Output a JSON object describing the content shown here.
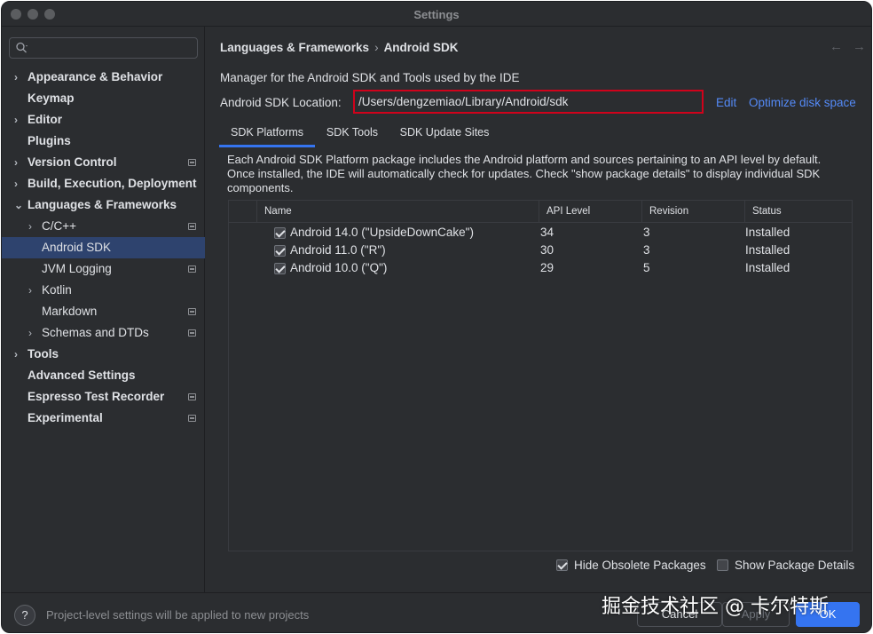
{
  "window": {
    "title": "Settings"
  },
  "sidebar": {
    "search": {
      "placeholder": "",
      "value": ""
    },
    "items": [
      {
        "label": "Appearance & Behavior",
        "chevron": "›",
        "bold": true
      },
      {
        "label": "Keymap",
        "chevron": "",
        "bold": true
      },
      {
        "label": "Editor",
        "chevron": "›",
        "bold": true
      },
      {
        "label": "Plugins",
        "chevron": "",
        "bold": true
      },
      {
        "label": "Version Control",
        "chevron": "›",
        "bold": true,
        "project": true
      },
      {
        "label": "Build, Execution, Deployment",
        "chevron": "›",
        "bold": true
      },
      {
        "label": "Languages & Frameworks",
        "chevron": "⌄",
        "bold": true
      },
      {
        "label": "C/C++",
        "chevron": "›",
        "bold": false,
        "project": true
      },
      {
        "label": "Android SDK",
        "chevron": "",
        "bold": false,
        "selected": true
      },
      {
        "label": "JVM Logging",
        "chevron": "",
        "bold": false,
        "project": true
      },
      {
        "label": "Kotlin",
        "chevron": "›",
        "bold": false
      },
      {
        "label": "Markdown",
        "chevron": "",
        "bold": false,
        "project": true
      },
      {
        "label": "Schemas and DTDs",
        "chevron": "›",
        "bold": false,
        "project": true
      },
      {
        "label": "Tools",
        "chevron": "›",
        "bold": true
      },
      {
        "label": "Advanced Settings",
        "chevron": "",
        "bold": true
      },
      {
        "label": "Espresso Test Recorder",
        "chevron": "",
        "bold": true,
        "project": true
      },
      {
        "label": "Experimental",
        "chevron": "",
        "bold": true,
        "project": true
      }
    ]
  },
  "breadcrumb": {
    "parent": "Languages & Frameworks",
    "separator": "›",
    "current": "Android SDK"
  },
  "nav": {
    "back": "←",
    "forward": "→"
  },
  "main": {
    "description": "Manager for the Android SDK and Tools used by the IDE",
    "location_label": "Android SDK Location:",
    "location_value": "/Users/dengzemiao/Library/Android/sdk",
    "edit_link": "Edit",
    "optimize_link": "Optimize disk space",
    "tabs": [
      {
        "label": "SDK Platforms",
        "active": true
      },
      {
        "label": "SDK Tools",
        "active": false
      },
      {
        "label": "SDK Update Sites",
        "active": false
      }
    ],
    "intro": "Each Android SDK Platform package includes the Android platform and sources pertaining to an API level by default. Once installed, the IDE will automatically check for updates. Check \"show package details\" to display individual SDK components.",
    "table": {
      "columns": [
        "Name",
        "API Level",
        "Revision",
        "Status"
      ],
      "rows": [
        {
          "checked": true,
          "name": "Android 14.0 (\"UpsideDownCake\")",
          "api": "34",
          "revision": "3",
          "status": "Installed"
        },
        {
          "checked": true,
          "name": "Android 11.0 (\"R\")",
          "api": "30",
          "revision": "3",
          "status": "Installed"
        },
        {
          "checked": true,
          "name": "Android 10.0 (\"Q\")",
          "api": "29",
          "revision": "5",
          "status": "Installed"
        }
      ]
    },
    "hide_obsolete": {
      "label": "Hide Obsolete Packages",
      "checked": true
    },
    "show_details": {
      "label": "Show Package Details",
      "checked": false
    }
  },
  "footer": {
    "help": "?",
    "note": "Project-level settings will be applied to new projects",
    "cancel": "Cancel",
    "apply": "Apply",
    "ok": "OK"
  },
  "watermark": "掘金技术社区 @ 卡尔特斯",
  "colors": {
    "accent": "#3574f0",
    "link": "#548af7",
    "selection": "#2e436e",
    "highlight_border": "#d0021b",
    "background": "#2b2d30"
  }
}
